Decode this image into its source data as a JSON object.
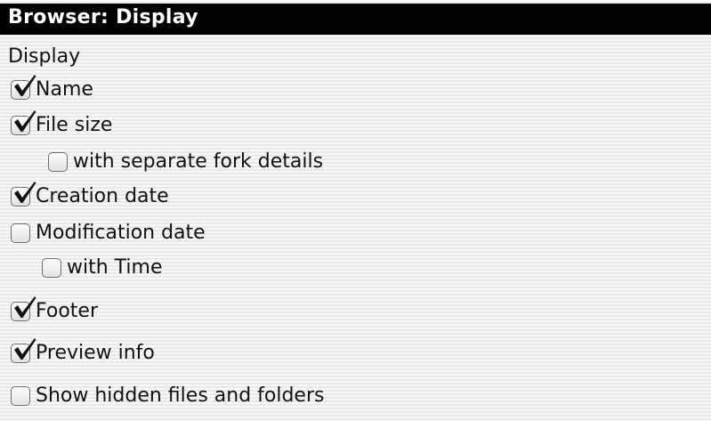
{
  "panel": {
    "title": "Browser: Display",
    "section_label": "Display"
  },
  "options": [
    {
      "label": "Name",
      "checked": true
    },
    {
      "label": "File size",
      "checked": true
    },
    {
      "label": "with separate fork details",
      "checked": false
    },
    {
      "label": "Creation date",
      "checked": true
    },
    {
      "label": "Modification date",
      "checked": false
    },
    {
      "label": "with Time",
      "checked": false
    },
    {
      "label": "Footer",
      "checked": true
    },
    {
      "label": "Preview info",
      "checked": true
    },
    {
      "label": "Show hidden files and folders",
      "checked": false
    }
  ],
  "icons": {
    "check": "checkmark-icon"
  }
}
